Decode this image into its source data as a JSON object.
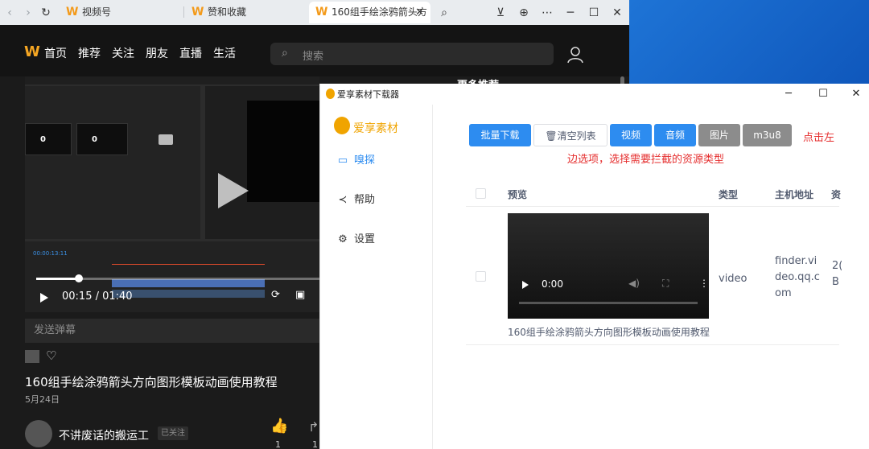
{
  "browser": {
    "tabs": [
      {
        "label": "视频号",
        "icon": "w-logo-icon"
      },
      {
        "label": "赞和收藏",
        "icon": "w-logo-icon"
      },
      {
        "label": "160组手绘涂鸦箭头方",
        "icon": "w-logo-icon",
        "active": true
      }
    ]
  },
  "site": {
    "nav": [
      "首页",
      "推荐",
      "关注",
      "朋友",
      "直播",
      "生活"
    ],
    "search_placeholder": "搜索",
    "player": {
      "time": "00:15 / 01:40",
      "progress": 0.15,
      "editor_timecode": "00:00:13:11"
    },
    "danmu_placeholder": "发送弹幕",
    "video_title": "160组手绘涂鸦箭头方向图形模板动画使用教程",
    "video_date": "5月24日",
    "author": "不讲废话的搬运工",
    "follow_status": "已关注",
    "like_count": "1",
    "share_count": "1",
    "right_heading": "更多推荐"
  },
  "app": {
    "title": "爱享素材下载器",
    "brand": "爱享素材",
    "sidebar": [
      {
        "label": "嗅探",
        "icon": "sniff-icon",
        "active": true
      },
      {
        "label": "帮助",
        "icon": "share-icon"
      },
      {
        "label": "设置",
        "icon": "gear-icon"
      }
    ],
    "toolbar": {
      "batch_download": "批量下载",
      "clear_list": "清空列表",
      "filter_video": "视频",
      "filter_audio": "音频",
      "filter_image": "图片",
      "filter_m3u8": "m3u8"
    },
    "hint_line1": "点击左",
    "hint_line2": "边选项，选择需要拦截的资源类型",
    "table": {
      "headers": {
        "preview": "预览",
        "type": "类型",
        "host": "主机地址",
        "size": "资"
      },
      "rows": [
        {
          "player_time": "0:00",
          "name": "160组手绘涂鸦箭头方向图形模板动画使用教程",
          "type": "video",
          "host": "finder.video.qq.com",
          "size": "2(\nB"
        }
      ]
    }
  },
  "colors": {
    "accent": "#2d8cf0",
    "brand": "#f0a400",
    "hint": "#e52d2d"
  }
}
